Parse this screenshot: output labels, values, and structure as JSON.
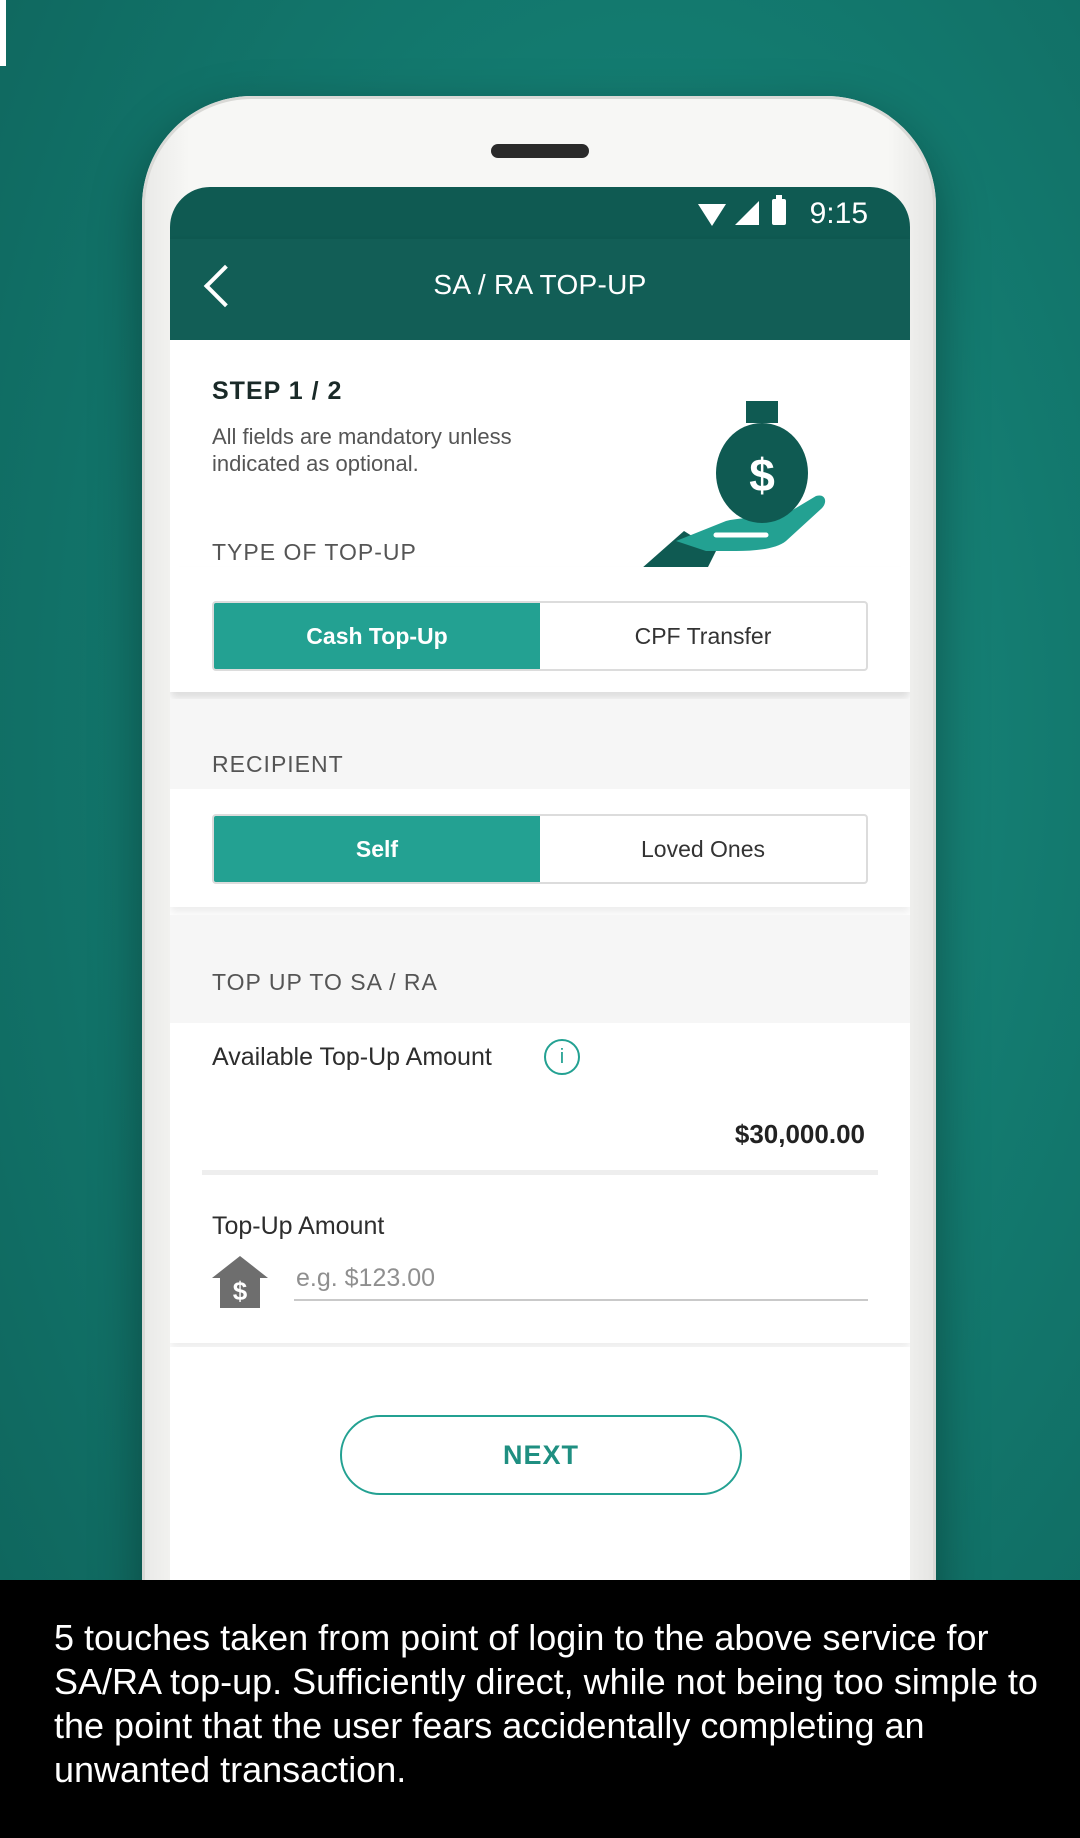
{
  "status_bar": {
    "time": "9:15"
  },
  "header": {
    "title": "SA / RA TOP-UP"
  },
  "step": {
    "title": "STEP 1 / 2",
    "instructions": "All fields are mandatory unless indicated as optional."
  },
  "top_up_type": {
    "label": "TYPE OF TOP-UP",
    "options": [
      "Cash Top-Up",
      "CPF Transfer"
    ],
    "selected": "Cash Top-Up"
  },
  "recipient": {
    "label": "RECIPIENT",
    "options": [
      "Self",
      "Loved Ones"
    ],
    "selected": "Self"
  },
  "top_up_to": {
    "label": "TOP UP TO SA / RA",
    "available_label": "Available Top-Up Amount",
    "available_value": "$30,000.00",
    "amount_label": "Top-Up Amount",
    "amount_placeholder": "e.g. $123.00",
    "amount_value": ""
  },
  "next_button": "NEXT",
  "caption": "5 touches taken from point of login to the above service for SA/RA top-up. Sufficiently direct, while not being too simple to the point  that the user fears accidentally completing an unwanted transaction.",
  "colors": {
    "background": "#137a6f",
    "header": "#125e56",
    "accent": "#23a192",
    "caption_background": "#000000"
  },
  "icons": [
    "back-icon",
    "wifi-icon",
    "signal-icon",
    "battery-icon",
    "money-bag-hand-icon",
    "info-icon",
    "money-house-icon"
  ]
}
